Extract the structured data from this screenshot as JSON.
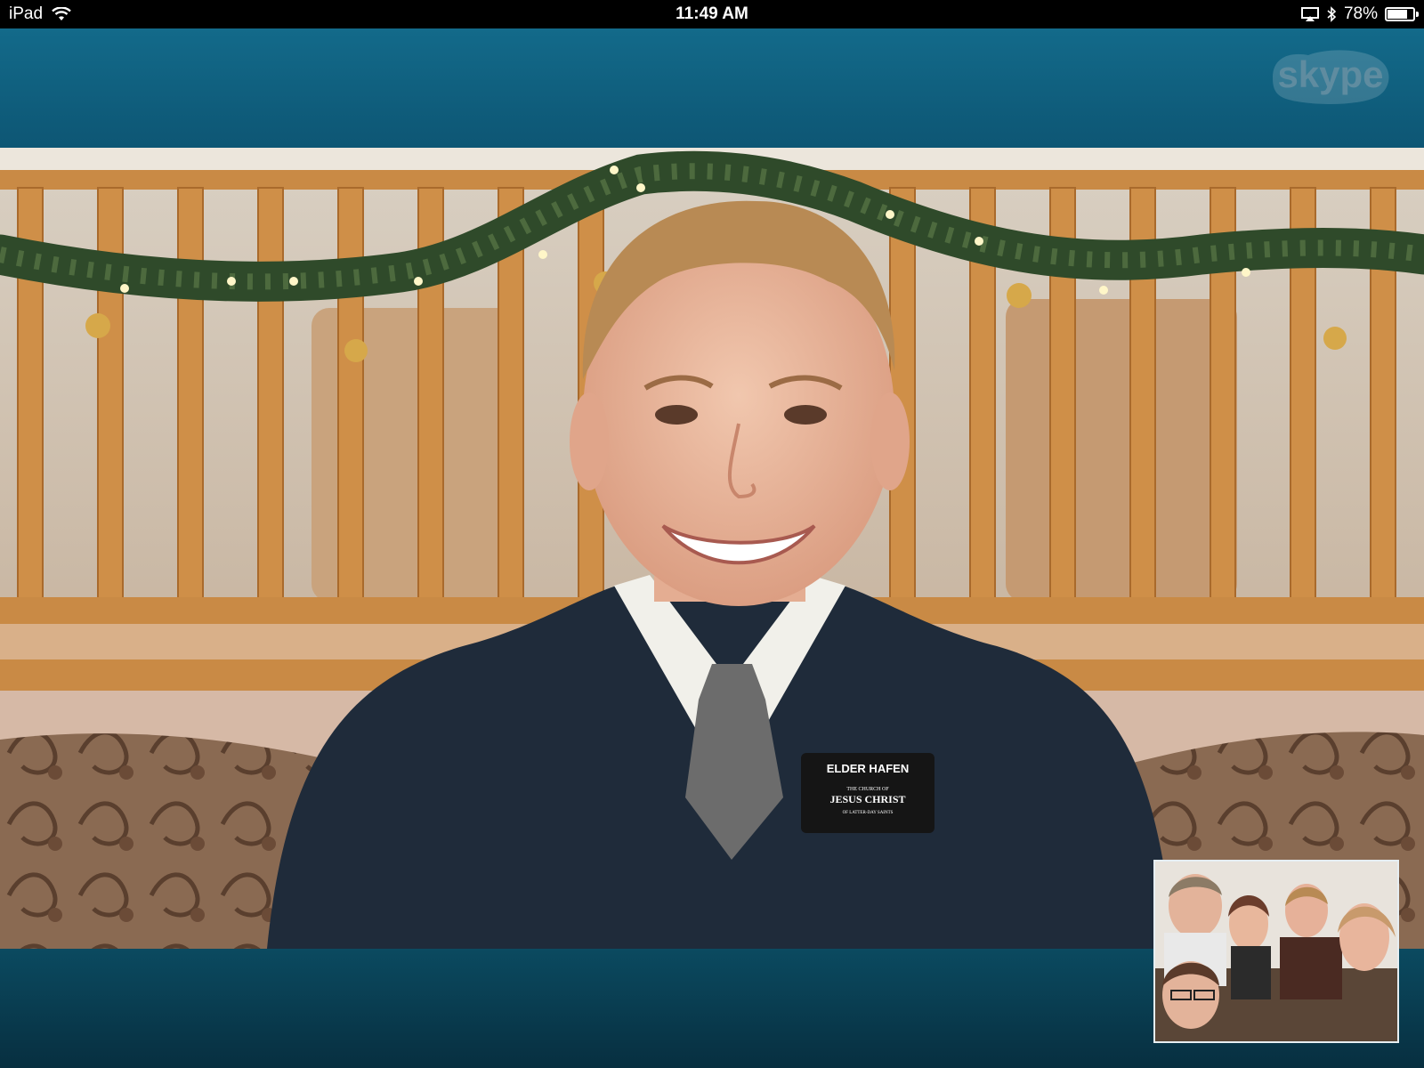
{
  "status_bar": {
    "device": "iPad",
    "time": "11:49 AM",
    "battery": "78%",
    "battery_level": 0.78
  },
  "header": {
    "logo_text": "skype"
  },
  "remote_video": {
    "name_tag": {
      "name": "ELDER HAFEN",
      "line1": "THE CHURCH OF",
      "line2": "JESUS CHRIST",
      "line3": "OF LATTER-DAY SAINTS"
    }
  },
  "icons": {
    "wifi": "wifi-icon",
    "airplay": "airplay-icon",
    "bluetooth": "bluetooth-icon",
    "battery": "battery-icon"
  },
  "colors": {
    "header": "#136a8a",
    "footer": "#072f40",
    "status_bar": "#000000"
  }
}
